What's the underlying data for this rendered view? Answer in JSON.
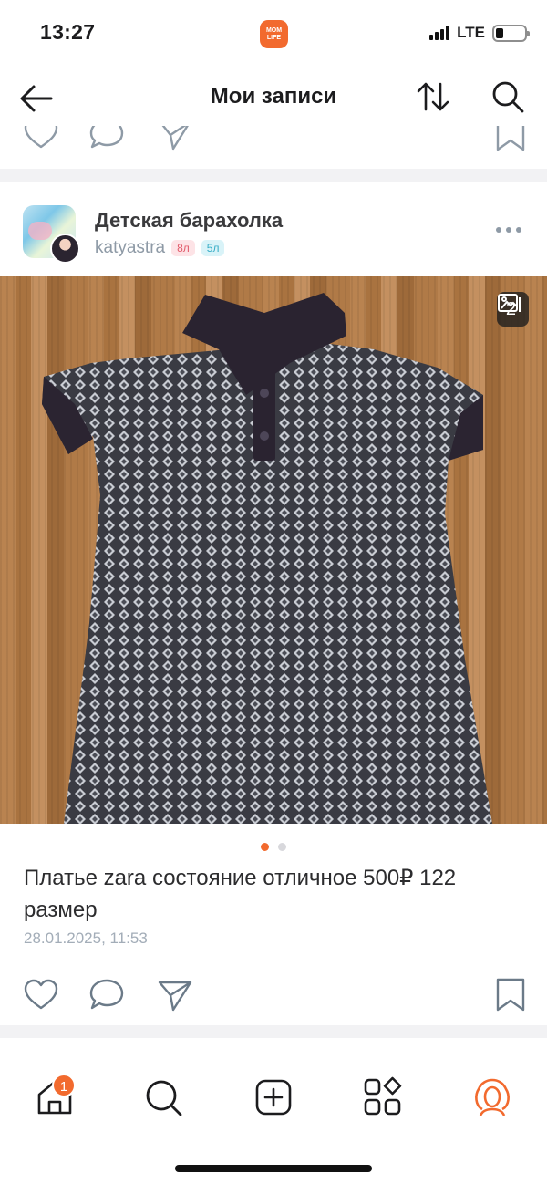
{
  "status": {
    "time": "13:27",
    "network": "LTE",
    "battery_level": 0.25,
    "app_logo_line1": "MOM",
    "app_logo_line2": "LIFE"
  },
  "header": {
    "title": "Мои записи",
    "icons": [
      "back-arrow-icon",
      "sort-icon",
      "search-icon"
    ]
  },
  "post": {
    "group_name": "Детская барахолка",
    "username": "katyastra",
    "badges": [
      "8л",
      "5л"
    ],
    "photo_count": "2",
    "photo_total": 2,
    "photo_current": 1,
    "text": "Платье zara состояние отличное 500₽ 122 размер",
    "date": "28.01.2025, 11:53",
    "actions": [
      "like-icon",
      "comment-icon",
      "share-icon",
      "bookmark-icon"
    ]
  },
  "tabbar": {
    "home_badge": "1",
    "tabs": [
      "home-icon",
      "search-icon",
      "create-icon",
      "services-icon",
      "profile-icon"
    ]
  },
  "colors": {
    "accent": "#f26a2e",
    "muted_text": "#8e9aa6",
    "icon_stroke": "#6b7a88"
  }
}
